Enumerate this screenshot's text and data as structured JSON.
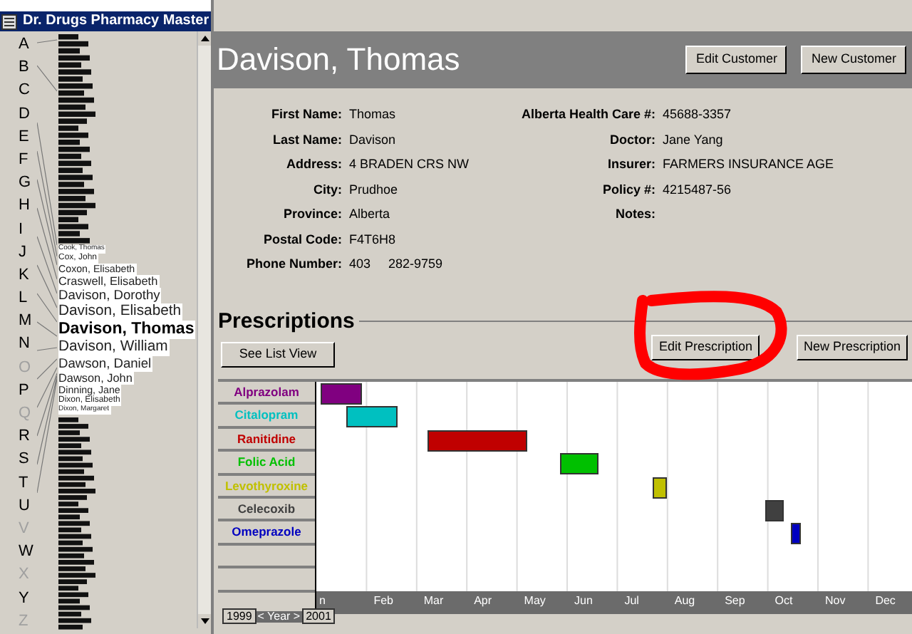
{
  "window": {
    "title": "Dr. Drugs Pharmacy Master"
  },
  "index": {
    "letters": [
      {
        "label": "A",
        "disabled": false
      },
      {
        "label": "B",
        "disabled": false
      },
      {
        "label": "C",
        "disabled": false
      },
      {
        "label": "D",
        "disabled": false
      },
      {
        "label": "E",
        "disabled": false
      },
      {
        "label": "F",
        "disabled": false
      },
      {
        "label": "G",
        "disabled": false
      },
      {
        "label": "H",
        "disabled": false
      },
      {
        "label": "I",
        "disabled": false
      },
      {
        "label": "J",
        "disabled": false
      },
      {
        "label": "K",
        "disabled": false
      },
      {
        "label": "L",
        "disabled": false
      },
      {
        "label": "M",
        "disabled": false
      },
      {
        "label": "N",
        "disabled": false
      },
      {
        "label": "O",
        "disabled": true
      },
      {
        "label": "P",
        "disabled": false
      },
      {
        "label": "Q",
        "disabled": true
      },
      {
        "label": "R",
        "disabled": false
      },
      {
        "label": "S",
        "disabled": false
      },
      {
        "label": "T",
        "disabled": false
      },
      {
        "label": "U",
        "disabled": false
      },
      {
        "label": "V",
        "disabled": true
      },
      {
        "label": "W",
        "disabled": false
      },
      {
        "label": "X",
        "disabled": true
      },
      {
        "label": "Y",
        "disabled": false
      },
      {
        "label": "Z",
        "disabled": true
      }
    ],
    "names": [
      {
        "label": "Cook, Thomas",
        "selected": false
      },
      {
        "label": "Cox, John",
        "selected": false
      },
      {
        "label": "Coxon, Elisabeth",
        "selected": false
      },
      {
        "label": "Craswell, Elisabeth",
        "selected": false
      },
      {
        "label": "Davison, Dorothy",
        "selected": false
      },
      {
        "label": "Davison, Elisabeth",
        "selected": false
      },
      {
        "label": "Davison, Thomas",
        "selected": true
      },
      {
        "label": "Davison, William",
        "selected": false
      },
      {
        "label": "Dawson, Daniel",
        "selected": false
      },
      {
        "label": "Dawson, John",
        "selected": false
      },
      {
        "label": "Dinning, Jane",
        "selected": false
      },
      {
        "label": "Dixon, Elisabeth",
        "selected": false
      },
      {
        "label": "Dixon, Margaret",
        "selected": false
      }
    ]
  },
  "customer": {
    "name": "Davison, Thomas",
    "buttons": [
      "Edit Customer",
      "New Customer"
    ],
    "left_fields": [
      {
        "label": "First Name:",
        "value": "Thomas"
      },
      {
        "label": "Last Name:",
        "value": "Davison"
      },
      {
        "label": "Address:",
        "value": "4 BRADEN CRS NW"
      },
      {
        "label": "City:",
        "value": "Prudhoe"
      },
      {
        "label": "Province:",
        "value": "Alberta"
      },
      {
        "label": "Postal Code:",
        "value": "F4T6H8"
      },
      {
        "label": "Phone Number:",
        "value": "403     282-9759"
      }
    ],
    "right_fields": [
      {
        "label": "Alberta Health Care #:",
        "value": "45688-3357"
      },
      {
        "label": "Doctor:",
        "value": "Jane Yang"
      },
      {
        "label": "Insurer:",
        "value": "FARMERS INSURANCE AGE"
      },
      {
        "label": "Policy #:",
        "value": "4215487-56"
      },
      {
        "label": "Notes:"
      }
    ]
  },
  "prescriptions": {
    "title": "Prescriptions",
    "list_button": "See List View",
    "buttons": [
      "Edit Prescription",
      "New Prescription"
    ],
    "drugs": [
      {
        "name": "Alprazolam",
        "color": "#800080"
      },
      {
        "name": "Citalopram",
        "color": "#00c0c0"
      },
      {
        "name": "Ranitidine",
        "color": "#c00000"
      },
      {
        "name": "Folic Acid",
        "color": "#00c000"
      },
      {
        "name": "Levothyroxine",
        "color": "#c0c000"
      },
      {
        "name": "Celecoxib",
        "color": "#404040"
      },
      {
        "name": "Omeprazole",
        "color": "#0000c0"
      }
    ],
    "prev_year": "1999",
    "year_label": "< Year >",
    "next_year": "2001",
    "months": [
      "n",
      "Feb",
      "Mar",
      "Apr",
      "May",
      "Jun",
      "Jul",
      "Aug",
      "Sep",
      "Oct",
      "Nov",
      "Dec"
    ]
  }
}
